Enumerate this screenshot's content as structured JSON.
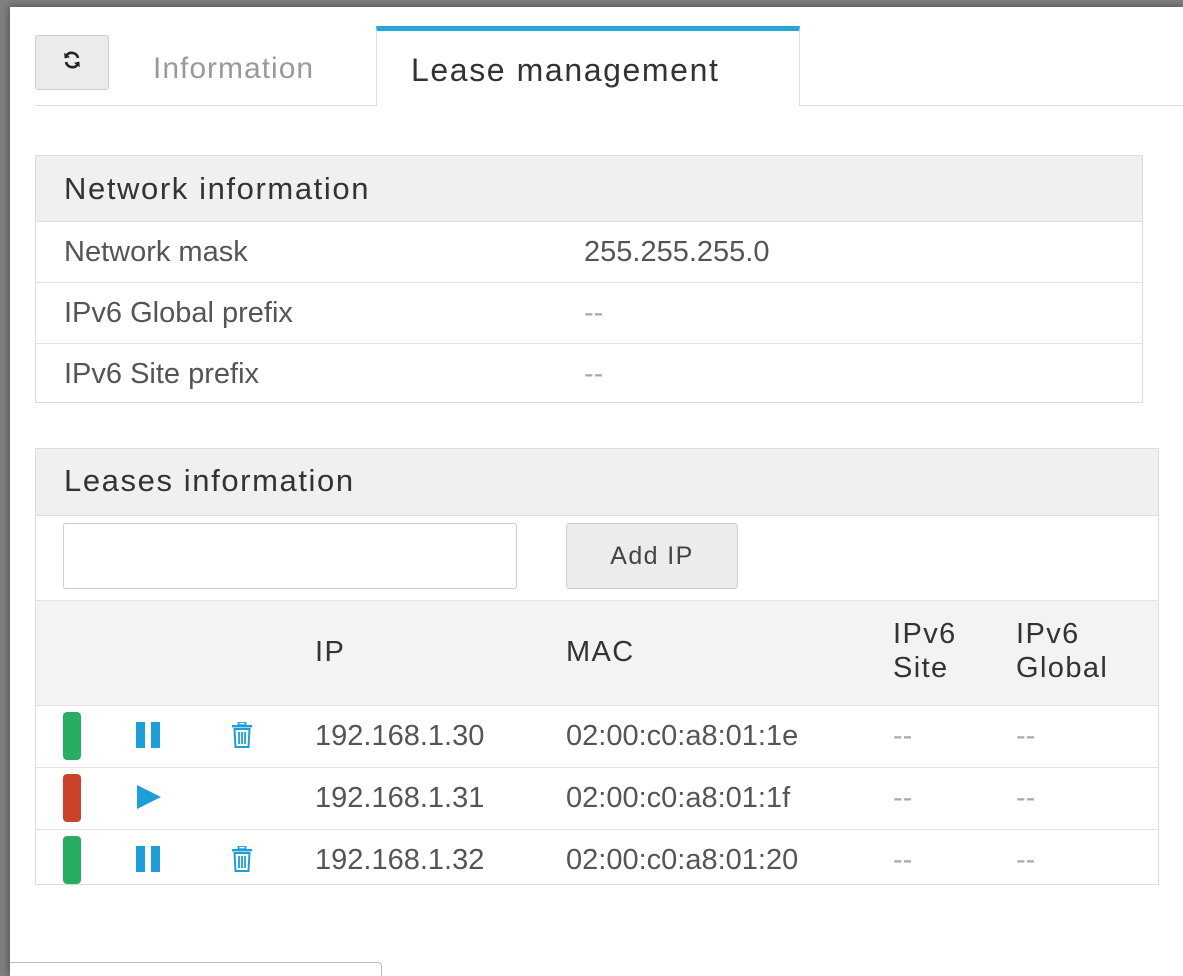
{
  "tabs": {
    "information": "Information",
    "lease_management": "Lease management"
  },
  "network": {
    "title": "Network information",
    "rows": [
      {
        "label": "Network mask",
        "value": "255.255.255.0"
      },
      {
        "label": "IPv6 Global prefix",
        "value": "--"
      },
      {
        "label": "IPv6 Site prefix",
        "value": "--"
      }
    ]
  },
  "leases": {
    "title": "Leases information",
    "input_value": "",
    "add_button": "Add IP",
    "headers": {
      "ip": "IP",
      "mac": "MAC",
      "ipv6_site_line1": "IPv6",
      "ipv6_site_line2": "Site",
      "ipv6_global_line1": "IPv6",
      "ipv6_global_line2": "Global"
    },
    "rows": [
      {
        "status_color": "#27ae60",
        "action_icon": "pause-icon",
        "deletable": true,
        "ip": "192.168.1.30",
        "mac": "02:00:c0:a8:01:1e",
        "ipv6_site": "--",
        "ipv6_global": "--"
      },
      {
        "status_color": "#c9432b",
        "action_icon": "play-icon",
        "deletable": false,
        "ip": "192.168.1.31",
        "mac": "02:00:c0:a8:01:1f",
        "ipv6_site": "--",
        "ipv6_global": "--"
      },
      {
        "status_color": "#27ae60",
        "action_icon": "pause-icon",
        "deletable": true,
        "ip": "192.168.1.32",
        "mac": "02:00:c0:a8:01:20",
        "ipv6_site": "--",
        "ipv6_global": "--"
      }
    ]
  },
  "colors": {
    "accent": "#2aa7d8",
    "status_active": "#27ae60",
    "status_held": "#c9432b",
    "icon_blue": "#1e9ed6"
  }
}
